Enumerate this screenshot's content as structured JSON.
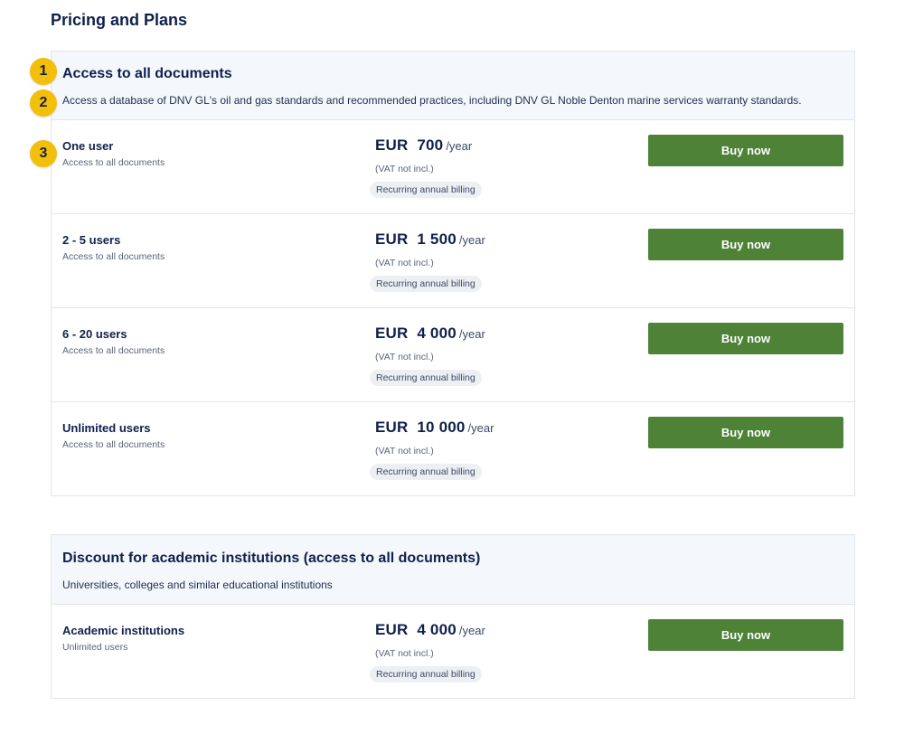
{
  "page": {
    "title": "Pricing and Plans"
  },
  "callouts": [
    "1",
    "2",
    "3"
  ],
  "sections": [
    {
      "title": "Access to all documents",
      "description": "Access a database of DNV GL's oil and gas standards and recommended practices, including DNV GL Noble Denton marine services warranty standards.",
      "plans": [
        {
          "name": "One user",
          "subtitle": "Access to all documents",
          "price": "EUR  700",
          "period": "/year",
          "vat": "(VAT not incl.)",
          "billing": "Recurring annual billing",
          "button": "Buy now"
        },
        {
          "name": "2 - 5 users",
          "subtitle": "Access to all documents",
          "price": "EUR  1 500",
          "period": "/year",
          "vat": "(VAT not incl.)",
          "billing": "Recurring annual billing",
          "button": "Buy now"
        },
        {
          "name": "6 - 20 users",
          "subtitle": "Access to all documents",
          "price": "EUR  4 000",
          "period": "/year",
          "vat": "(VAT not incl.)",
          "billing": "Recurring annual billing",
          "button": "Buy now"
        },
        {
          "name": "Unlimited users",
          "subtitle": "Access to all documents",
          "price": "EUR  10 000",
          "period": "/year",
          "vat": "(VAT not incl.)",
          "billing": "Recurring annual billing",
          "button": "Buy now"
        }
      ]
    },
    {
      "title": "Discount for academic institutions (access to all documents)",
      "description": "Universities, colleges and similar educational institutions",
      "plans": [
        {
          "name": "Academic institutions",
          "subtitle": "Unlimited users",
          "price": "EUR  4 000",
          "period": "/year",
          "vat": "(VAT not incl.)",
          "billing": "Recurring annual billing",
          "button": "Buy now"
        }
      ]
    }
  ],
  "colors": {
    "accent_button": "#4d8237",
    "header_bg": "#f4f8fc",
    "callout": "#f2c00c",
    "text": "#0f204b"
  }
}
